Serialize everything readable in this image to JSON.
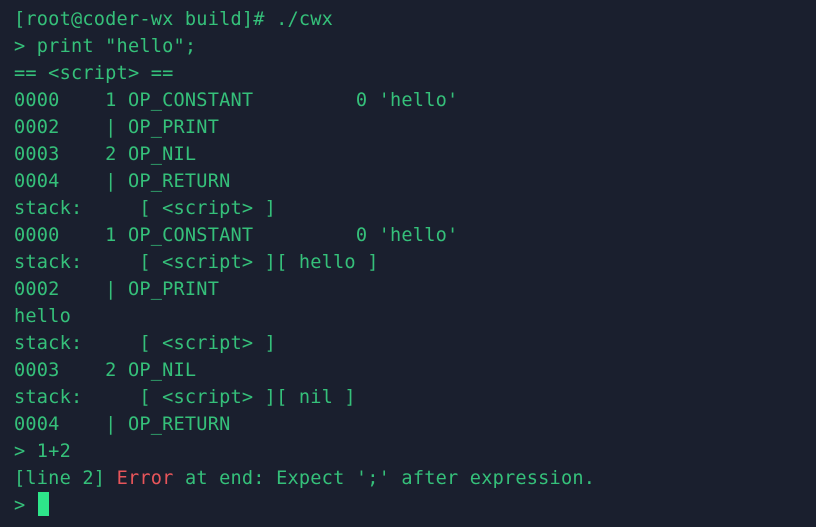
{
  "terminal": {
    "lines": [
      "[root@coder-wx build]# ./cwx",
      "> print \"hello\";",
      "== <script> ==",
      "0000    1 OP_CONSTANT         0 'hello'",
      "0002    | OP_PRINT",
      "0003    2 OP_NIL",
      "0004    | OP_RETURN",
      "stack:     [ <script> ]",
      "0000    1 OP_CONSTANT         0 'hello'",
      "stack:     [ <script> ][ hello ]",
      "0002    | OP_PRINT",
      "hello",
      "stack:     [ <script> ]",
      "0003    2 OP_NIL",
      "stack:     [ <script> ][ nil ]",
      "0004    | OP_RETURN",
      "> 1+2"
    ],
    "error_line": {
      "prefix": "[line 2] ",
      "error_word": "Error",
      "suffix": " at end: Expect ';' after expression."
    },
    "prompt": ">"
  },
  "colors": {
    "background": "#1a1f2e",
    "text": "#35c07a",
    "error": "#e8555a",
    "cursor": "#2ee58a"
  }
}
